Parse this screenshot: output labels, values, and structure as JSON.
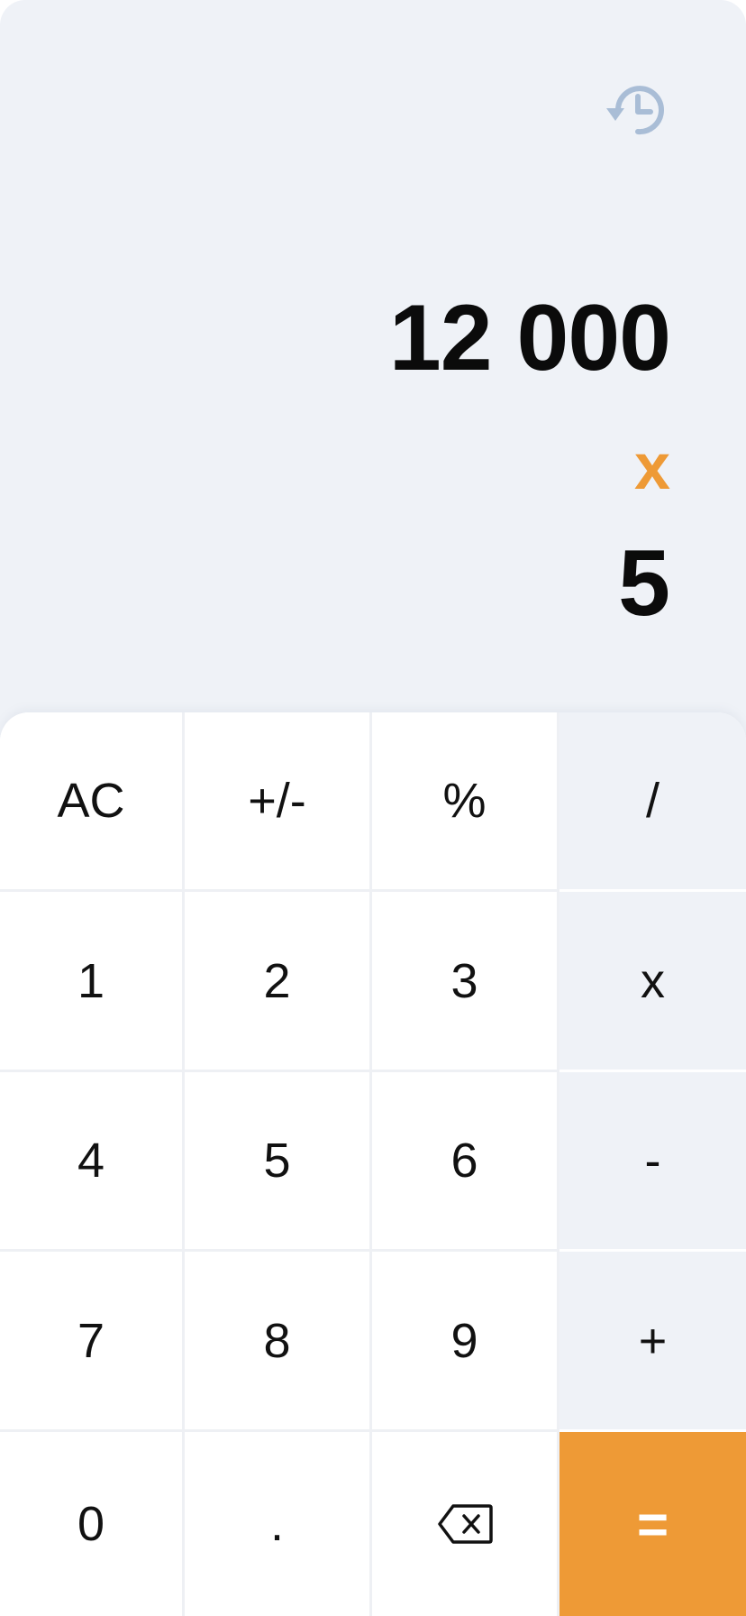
{
  "display": {
    "operand1": "12 000",
    "operator": "x",
    "operand2": "5"
  },
  "keys": {
    "ac": "AC",
    "sign": "+/-",
    "percent": "%",
    "divide": "/",
    "one": "1",
    "two": "2",
    "three": "3",
    "multiply": "x",
    "four": "4",
    "five": "5",
    "six": "6",
    "minus": "-",
    "seven": "7",
    "eight": "8",
    "nine": "9",
    "plus": "+",
    "zero": "0",
    "dot": ".",
    "equals": "="
  },
  "icons": {
    "history": "history-icon",
    "backspace": "backspace-icon"
  },
  "colors": {
    "accent": "#ee9a36",
    "background": "#eff2f7",
    "history_icon": "#a9bdd6"
  }
}
